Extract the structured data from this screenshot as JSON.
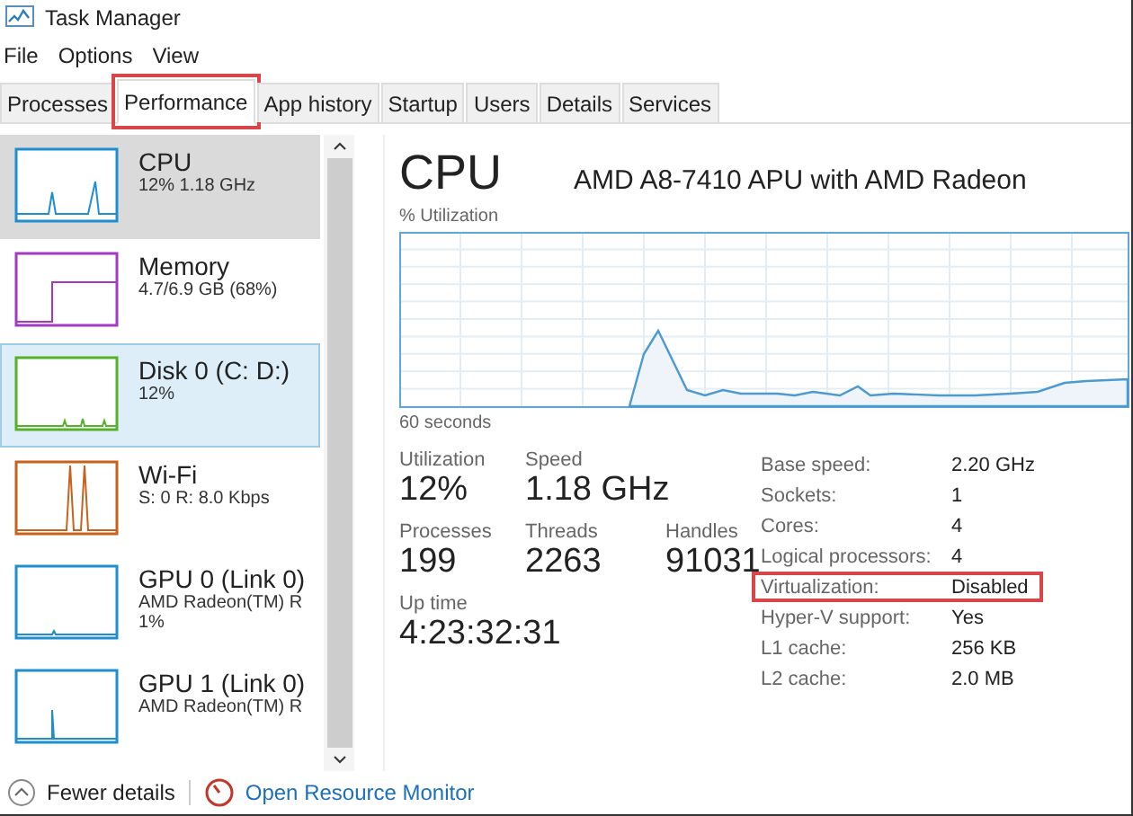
{
  "window": {
    "title": "Task Manager"
  },
  "menu": [
    "File",
    "Options",
    "View"
  ],
  "tabs": [
    {
      "label": "Processes",
      "selected": false,
      "highlighted": false
    },
    {
      "label": "Performance",
      "selected": true,
      "highlighted": true
    },
    {
      "label": "App history",
      "selected": false,
      "highlighted": false
    },
    {
      "label": "Startup",
      "selected": false,
      "highlighted": false
    },
    {
      "label": "Users",
      "selected": false,
      "highlighted": false
    },
    {
      "label": "Details",
      "selected": false,
      "highlighted": false
    },
    {
      "label": "Services",
      "selected": false,
      "highlighted": false
    }
  ],
  "sidebar": {
    "items": [
      {
        "kind": "cpu",
        "name": "CPU",
        "lines": [
          "12%  1.18 GHz"
        ],
        "color": "#1f8ecf",
        "selected": true,
        "hovered": false
      },
      {
        "kind": "memory",
        "name": "Memory",
        "lines": [
          "4.7/6.9 GB (68%)"
        ],
        "color": "#a43ac4",
        "selected": false,
        "hovered": false
      },
      {
        "kind": "disk",
        "name": "Disk 0 (C: D:)",
        "lines": [
          "12%"
        ],
        "color": "#55b02b",
        "selected": false,
        "hovered": true
      },
      {
        "kind": "wifi",
        "name": "Wi-Fi",
        "lines": [
          "S: 0 R: 8.0 Kbps"
        ],
        "color": "#c7621d",
        "selected": false,
        "hovered": false
      },
      {
        "kind": "gpu",
        "name": "GPU 0 (Link 0)",
        "lines": [
          "AMD Radeon(TM) R",
          "1%"
        ],
        "color": "#1f8ecf",
        "selected": false,
        "hovered": false
      },
      {
        "kind": "gpu2",
        "name": "GPU 1 (Link 0)",
        "lines": [
          "AMD Radeon(TM) R"
        ],
        "color": "#1f8ecf",
        "selected": false,
        "hovered": false
      }
    ]
  },
  "main": {
    "title": "CPU",
    "model": "AMD A8-7410 APU with AMD Radeon",
    "graph_label": "% Utilization",
    "graph_time": "60 seconds",
    "stats": [
      [
        {
          "label": "Utilization",
          "value": "12%"
        },
        {
          "label": "Speed",
          "value": "1.18 GHz"
        }
      ],
      [
        {
          "label": "Processes",
          "value": "199"
        },
        {
          "label": "Threads",
          "value": "2263"
        },
        {
          "label": "Handles",
          "value": "91031"
        }
      ],
      [
        {
          "label": "Up time",
          "value": "4:23:32:31"
        }
      ]
    ],
    "specs": [
      {
        "label": "Base speed:",
        "value": "2.20 GHz",
        "highlighted": false
      },
      {
        "label": "Sockets:",
        "value": "1",
        "highlighted": false
      },
      {
        "label": "Cores:",
        "value": "4",
        "highlighted": false
      },
      {
        "label": "Logical processors:",
        "value": "4",
        "highlighted": false
      },
      {
        "label": "Virtualization:",
        "value": "Disabled",
        "highlighted": true
      },
      {
        "label": "Hyper-V support:",
        "value": "Yes",
        "highlighted": false
      },
      {
        "label": "L1 cache:",
        "value": "256 KB",
        "highlighted": false
      },
      {
        "label": "L2 cache:",
        "value": "2.0 MB",
        "highlighted": false
      }
    ]
  },
  "footer": {
    "details": "Fewer details",
    "link": "Open Resource Monitor"
  }
}
